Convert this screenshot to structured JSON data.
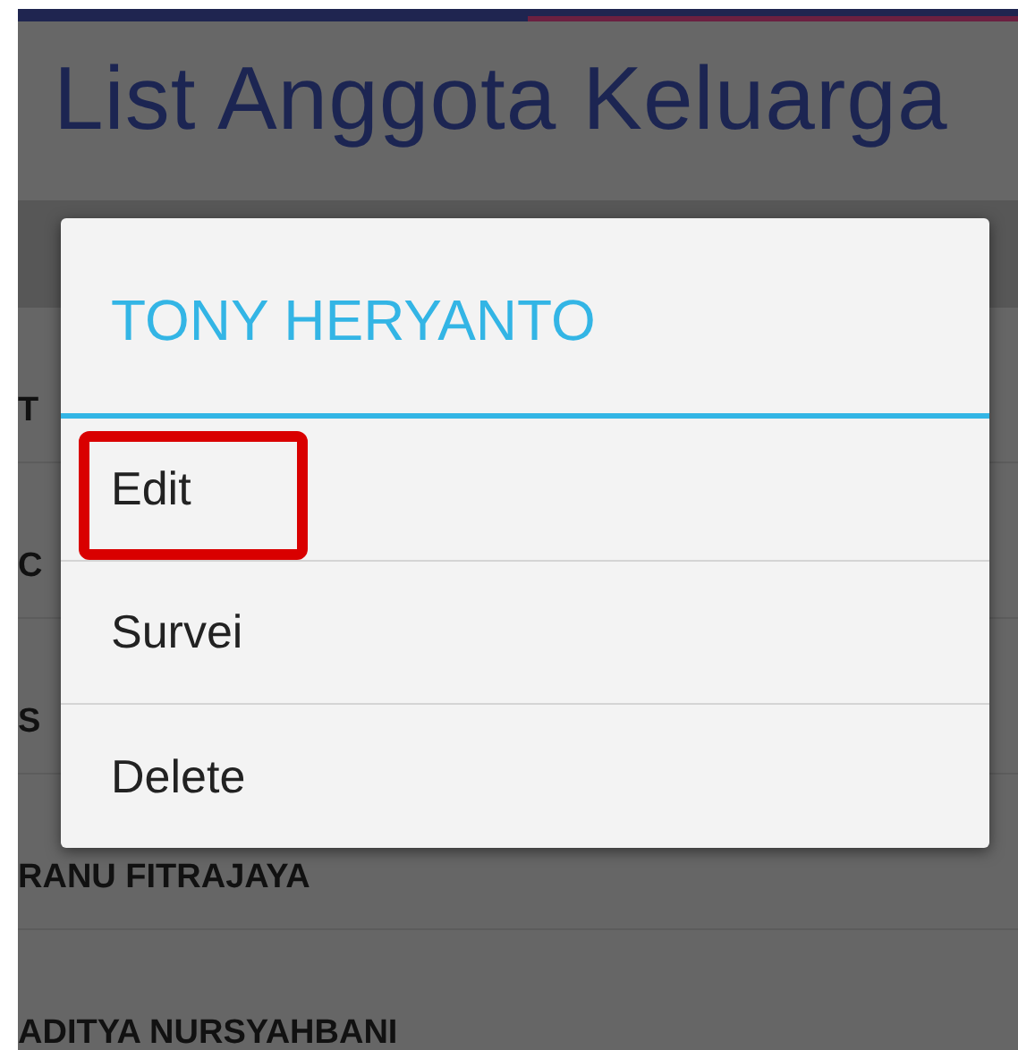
{
  "app_bar": {
    "title": "List Anggota Keluarga"
  },
  "list": [
    {
      "name": "T"
    },
    {
      "name": "C"
    },
    {
      "name": "S"
    },
    {
      "name": "RANU FITRAJAYA"
    },
    {
      "name": "ADITYA NURSYAHBANI"
    }
  ],
  "dialog": {
    "title": "TONY HERYANTO",
    "items": [
      {
        "label": "Edit",
        "highlighted": true
      },
      {
        "label": "Survei",
        "highlighted": false
      },
      {
        "label": "Delete",
        "highlighted": false
      }
    ]
  }
}
